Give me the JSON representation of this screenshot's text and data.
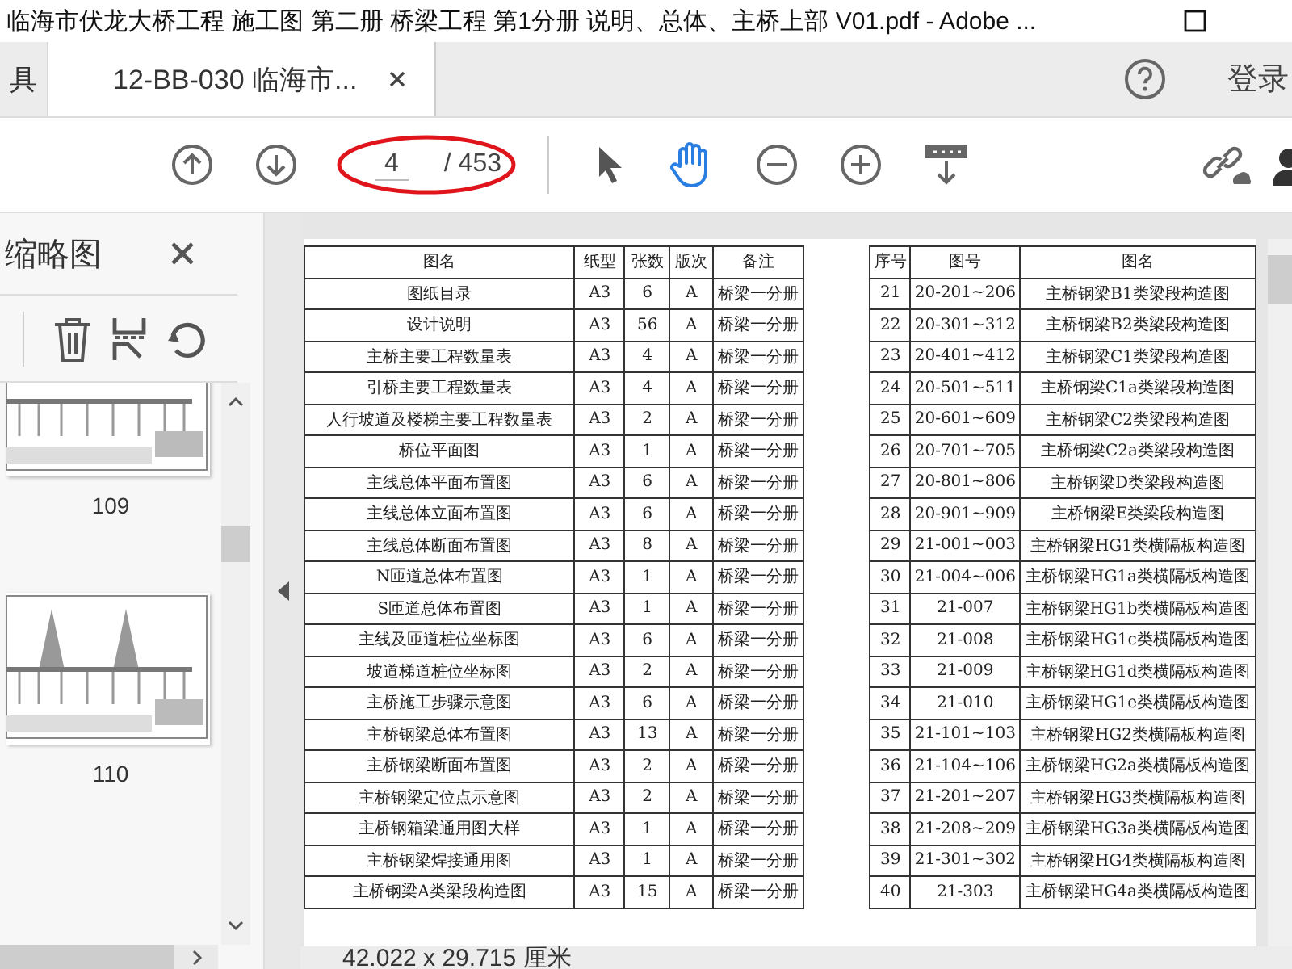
{
  "window": {
    "title": "临海市伏龙大桥工程 施工图 第二册 桥梁工程 第1分册 说明、总体、主桥上部 V01.pdf - Adobe ..."
  },
  "tabs": [
    {
      "label": "具",
      "selected": false
    },
    {
      "label": "12-BB-030 临海市...",
      "selected": true
    }
  ],
  "account": {
    "sign_in": "登录"
  },
  "toolbar": {
    "page_number": "4",
    "page_total": "/ 453",
    "tools": [
      {
        "kind": "select",
        "selected": false
      },
      {
        "kind": "hand",
        "selected": true
      }
    ]
  },
  "sidebar": {
    "title": "缩略图",
    "thumbnails": [
      {
        "label": "109"
      },
      {
        "label": "110"
      }
    ]
  },
  "document": {
    "table_left": {
      "columns": [
        "图名",
        "纸型",
        "张数",
        "版次",
        "备注"
      ],
      "rows": [
        [
          "图纸目录",
          "A3",
          "6",
          "A",
          "桥梁一分册"
        ],
        [
          "设计说明",
          "A3",
          "56",
          "A",
          "桥梁一分册"
        ],
        [
          "主桥主要工程数量表",
          "A3",
          "4",
          "A",
          "桥梁一分册"
        ],
        [
          "引桥主要工程数量表",
          "A3",
          "4",
          "A",
          "桥梁一分册"
        ],
        [
          "人行坡道及楼梯主要工程数量表",
          "A3",
          "2",
          "A",
          "桥梁一分册"
        ],
        [
          "桥位平面图",
          "A3",
          "1",
          "A",
          "桥梁一分册"
        ],
        [
          "主线总体平面布置图",
          "A3",
          "6",
          "A",
          "桥梁一分册"
        ],
        [
          "主线总体立面布置图",
          "A3",
          "6",
          "A",
          "桥梁一分册"
        ],
        [
          "主线总体断面布置图",
          "A3",
          "8",
          "A",
          "桥梁一分册"
        ],
        [
          "N匝道总体布置图",
          "A3",
          "1",
          "A",
          "桥梁一分册"
        ],
        [
          "S匝道总体布置图",
          "A3",
          "1",
          "A",
          "桥梁一分册"
        ],
        [
          "主线及匝道桩位坐标图",
          "A3",
          "6",
          "A",
          "桥梁一分册"
        ],
        [
          "坡道梯道桩位坐标图",
          "A3",
          "2",
          "A",
          "桥梁一分册"
        ],
        [
          "主桥施工步骤示意图",
          "A3",
          "6",
          "A",
          "桥梁一分册"
        ],
        [
          "主桥钢梁总体布置图",
          "A3",
          "13",
          "A",
          "桥梁一分册"
        ],
        [
          "主桥钢梁断面布置图",
          "A3",
          "2",
          "A",
          "桥梁一分册"
        ],
        [
          "主桥钢梁定位点示意图",
          "A3",
          "2",
          "A",
          "桥梁一分册"
        ],
        [
          "主桥钢箱梁通用图大样",
          "A3",
          "1",
          "A",
          "桥梁一分册"
        ],
        [
          "主桥钢梁焊接通用图",
          "A3",
          "1",
          "A",
          "桥梁一分册"
        ],
        [
          "主桥钢梁A类梁段构造图",
          "A3",
          "15",
          "A",
          "桥梁一分册"
        ]
      ]
    },
    "table_right": {
      "columns": [
        "序号",
        "图号",
        "图名"
      ],
      "rows": [
        [
          "21",
          "20-201~206",
          "主桥钢梁B1类梁段构造图"
        ],
        [
          "22",
          "20-301~312",
          "主桥钢梁B2类梁段构造图"
        ],
        [
          "23",
          "20-401~412",
          "主桥钢梁C1类梁段构造图"
        ],
        [
          "24",
          "20-501~511",
          "主桥钢梁C1a类梁段构造图"
        ],
        [
          "25",
          "20-601~609",
          "主桥钢梁C2类梁段构造图"
        ],
        [
          "26",
          "20-701~705",
          "主桥钢梁C2a类梁段构造图"
        ],
        [
          "27",
          "20-801~806",
          "主桥钢梁D类梁段构造图"
        ],
        [
          "28",
          "20-901~909",
          "主桥钢梁E类梁段构造图"
        ],
        [
          "29",
          "21-001~003",
          "主桥钢梁HG1类横隔板构造图"
        ],
        [
          "30",
          "21-004~006",
          "主桥钢梁HG1a类横隔板构造图"
        ],
        [
          "31",
          "21-007",
          "主桥钢梁HG1b类横隔板构造图"
        ],
        [
          "32",
          "21-008",
          "主桥钢梁HG1c类横隔板构造图"
        ],
        [
          "33",
          "21-009",
          "主桥钢梁HG1d类横隔板构造图"
        ],
        [
          "34",
          "21-010",
          "主桥钢梁HG1e类横隔板构造图"
        ],
        [
          "35",
          "21-101~103",
          "主桥钢梁HG2类横隔板构造图"
        ],
        [
          "36",
          "21-104~106",
          "主桥钢梁HG2a类横隔板构造图"
        ],
        [
          "37",
          "21-201~207",
          "主桥钢梁HG3类横隔板构造图"
        ],
        [
          "38",
          "21-208~209",
          "主桥钢梁HG3a类横隔板构造图"
        ],
        [
          "39",
          "21-301~302",
          "主桥钢梁HG4类横隔板构造图"
        ],
        [
          "40",
          "21-303",
          "主桥钢梁HG4a类横隔板构造图"
        ]
      ]
    }
  },
  "status_bar": {
    "page_size": "42.022 x 29.715 厘米"
  }
}
